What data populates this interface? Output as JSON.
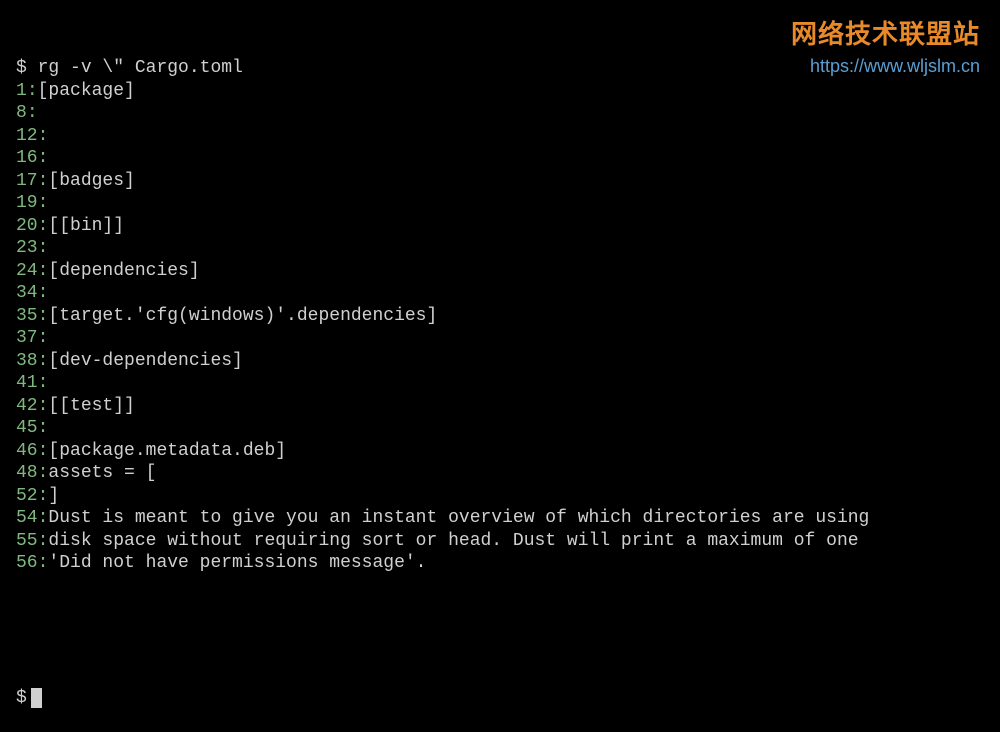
{
  "watermark": {
    "title": "网络技术联盟站",
    "url": "https://www.wljslm.cn"
  },
  "prompt": "$",
  "command": "rg -v \\\" Cargo.toml",
  "lines": [
    {
      "n": "1",
      "text": "[package]"
    },
    {
      "n": "8",
      "text": ""
    },
    {
      "n": "12",
      "text": ""
    },
    {
      "n": "16",
      "text": ""
    },
    {
      "n": "17",
      "text": "[badges]"
    },
    {
      "n": "19",
      "text": ""
    },
    {
      "n": "20",
      "text": "[[bin]]"
    },
    {
      "n": "23",
      "text": ""
    },
    {
      "n": "24",
      "text": "[dependencies]"
    },
    {
      "n": "34",
      "text": ""
    },
    {
      "n": "35",
      "text": "[target.'cfg(windows)'.dependencies]"
    },
    {
      "n": "37",
      "text": ""
    },
    {
      "n": "38",
      "text": "[dev-dependencies]"
    },
    {
      "n": "41",
      "text": ""
    },
    {
      "n": "42",
      "text": "[[test]]"
    },
    {
      "n": "45",
      "text": ""
    },
    {
      "n": "46",
      "text": "[package.metadata.deb]"
    },
    {
      "n": "48",
      "text": "assets = ["
    },
    {
      "n": "52",
      "text": "]"
    },
    {
      "n": "54",
      "text": "Dust is meant to give you an instant overview of which directories are using"
    },
    {
      "n": "55",
      "text": "disk space without requiring sort or head. Dust will print a maximum of one"
    },
    {
      "n": "56",
      "text": "'Did not have permissions message'."
    }
  ]
}
